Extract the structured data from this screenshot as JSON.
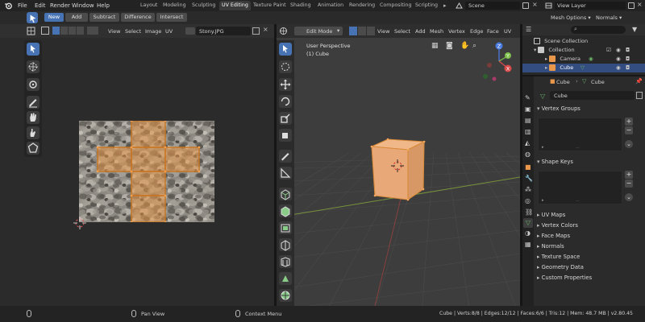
{
  "topbar": {
    "menus": [
      "File",
      "Edit",
      "Render",
      "Window",
      "Help"
    ],
    "workspaces": [
      "Layout",
      "Modeling",
      "Sculpting",
      "UV Editing",
      "Texture Paint",
      "Shading",
      "Animation",
      "Rendering",
      "Compositing",
      "Scripting"
    ],
    "active_workspace": "UV Editing",
    "scene": "Scene",
    "view_layer": "View Layer"
  },
  "header2": {
    "new": "New",
    "add": "Add",
    "subtract": "Subtract",
    "difference": "Difference",
    "intersect": "Intersect",
    "mesh_options": "Mesh Options",
    "normals": "Normals"
  },
  "uv_editor": {
    "menus": [
      "View",
      "Select",
      "Image",
      "UV"
    ],
    "image_name": "Stony.JPG"
  },
  "viewport": {
    "mode": "Edit Mode",
    "menus": [
      "View",
      "Select",
      "Add",
      "Mesh",
      "Vertex",
      "Edge",
      "Face",
      "UV"
    ],
    "perspective": "User Perspective",
    "object": "(1) Cube",
    "axis_labels": [
      "Z",
      "Y",
      "X"
    ]
  },
  "outliner": {
    "scene_collection": "Scene Collection",
    "collection": "Collection",
    "items": [
      "Camera",
      "Cube"
    ]
  },
  "properties": {
    "object_name": "Cube",
    "data_name": "Cube",
    "mesh_field": "Cube",
    "panels_open": [
      "Vertex Groups",
      "Shape Keys"
    ],
    "panels_closed": [
      "UV Maps",
      "Vertex Colors",
      "Face Maps",
      "Normals",
      "Texture Space",
      "Geometry Data",
      "Custom Properties"
    ]
  },
  "statusbar": {
    "pan": "Pan View",
    "context": "Context Menu",
    "stats": "Cube | Verts:8/8 | Edges:12/12 | Faces:6/6 | Tris:12 | Mem: 48.7 MB | v2.80.45"
  },
  "colors": {
    "accent": "#4772b3",
    "selection_orange": "#e8974b",
    "axis_x": "#d94a4a",
    "axis_y": "#7ec04a",
    "axis_z": "#4a7be0"
  }
}
